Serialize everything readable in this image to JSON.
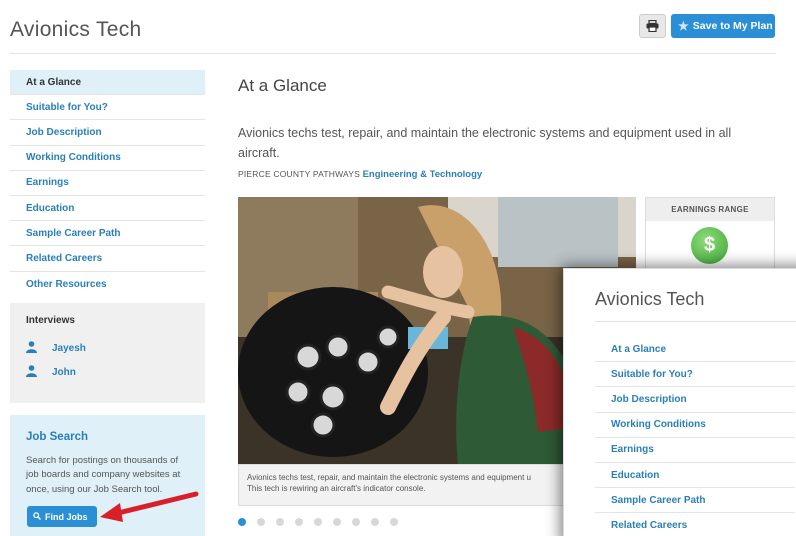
{
  "header": {
    "title": "Avionics Tech",
    "print_icon": "printer-icon",
    "save_label": "Save to My Plan",
    "save_icon": "star-icon"
  },
  "sidebar": {
    "nav": [
      {
        "label": "At a Glance",
        "active": true
      },
      {
        "label": "Suitable for You?"
      },
      {
        "label": "Job Description"
      },
      {
        "label": "Working Conditions"
      },
      {
        "label": "Earnings"
      },
      {
        "label": "Education"
      },
      {
        "label": "Sample Career Path"
      },
      {
        "label": "Related Careers"
      },
      {
        "label": "Other Resources"
      }
    ],
    "interviews": {
      "heading": "Interviews",
      "people": [
        {
          "name": "Jayesh",
          "icon": "person-icon"
        },
        {
          "name": "John",
          "icon": "person-icon"
        }
      ]
    },
    "job_search": {
      "heading": "Job Search",
      "description": "Search for postings on thousands of job boards and company websites at once, using our Job Search tool.",
      "button_label": "Find Jobs",
      "button_icon": "search-icon"
    }
  },
  "main": {
    "heading": "At a Glance",
    "summary": "Avionics techs test, repair, and maintain the electronic systems and equipment used in all aircraft.",
    "pathway_label": "PIERCE COUNTY PATHWAYS",
    "pathway_link": "Engineering & Technology",
    "caption_line1": "Avionics techs test, repair, and maintain the electronic systems and equipment u",
    "caption_line2": "This tech is rewiring an aircraft's indicator console.",
    "slide_count": 9,
    "active_slide": 1
  },
  "earnings": {
    "heading": "EARNINGS RANGE",
    "icon": "dollar-icon",
    "symbol": "$"
  },
  "zoom_inset": {
    "title": "Avionics Tech",
    "nav": [
      {
        "label": "At a Glance"
      },
      {
        "label": "Suitable for You?"
      },
      {
        "label": "Job Description"
      },
      {
        "label": "Working Conditions"
      },
      {
        "label": "Earnings"
      },
      {
        "label": "Education"
      },
      {
        "label": "Sample Career Path"
      },
      {
        "label": "Related Careers"
      }
    ]
  },
  "colors": {
    "accent": "#2b8fd6",
    "link": "#2a7fb8",
    "active_nav_bg": "#dff0f9",
    "annotation_arrow": "#d9202a"
  }
}
